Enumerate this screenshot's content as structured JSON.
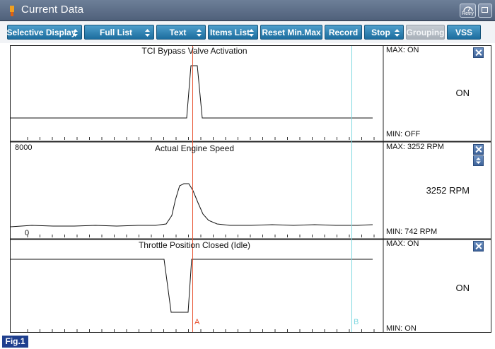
{
  "window": {
    "title": "Current Data",
    "retry_label": "Retry"
  },
  "toolbar": {
    "buttons": [
      {
        "label": "Selective Display",
        "has_spinner": true
      },
      {
        "label": "Full List",
        "has_spinner": true
      },
      {
        "label": "Text",
        "has_spinner": true
      },
      {
        "label": "Items List",
        "has_spinner": true
      },
      {
        "label": "Reset Min.Max",
        "has_spinner": false
      },
      {
        "label": "Record",
        "has_spinner": false
      },
      {
        "label": "Stop",
        "has_spinner": true
      },
      {
        "label": "Grouping",
        "has_spinner": false,
        "disabled": true
      },
      {
        "label": "VSS",
        "has_spinner": false
      }
    ]
  },
  "panels": [
    {
      "title": "TCI Bypass Valve Activation",
      "max_label": "MAX: ON",
      "min_label": "MIN: OFF",
      "current_value": "ON",
      "scale_top": "",
      "scale_bottom": ""
    },
    {
      "title": "Actual Engine Speed",
      "max_label": "MAX:  3252 RPM",
      "min_label": "MIN:   742 RPM",
      "current_value": "3252 RPM",
      "scale_top": "8000",
      "scale_bottom": "0"
    },
    {
      "title": "Throttle Position Closed (Idle)",
      "max_label": "MAX: ON",
      "min_label": "MIN: ON",
      "current_value": "ON",
      "scale_top": "",
      "scale_bottom": ""
    }
  ],
  "cursors": {
    "a_label": "A",
    "b_label": "B",
    "a_color": "#e8502e",
    "b_color": "#7dd8e0"
  },
  "figure_label": "Fig.1"
}
